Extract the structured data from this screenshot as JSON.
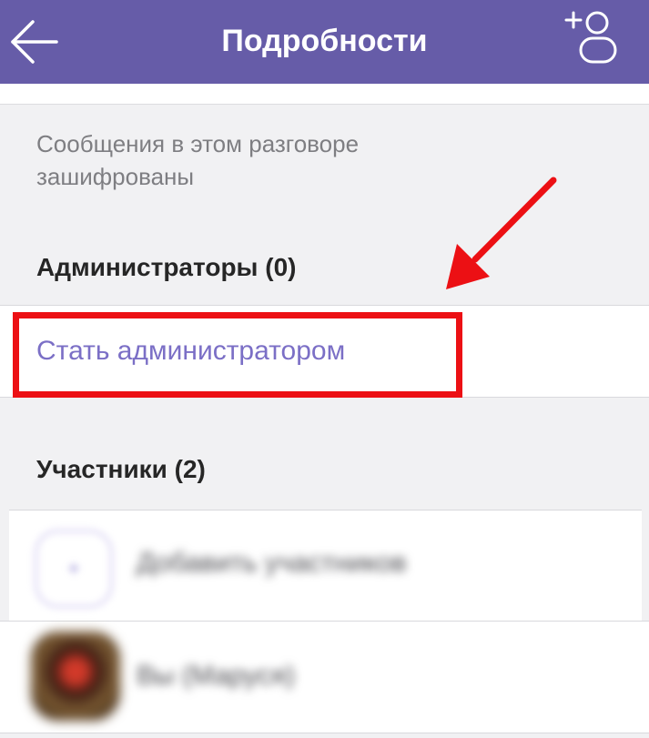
{
  "header": {
    "title": "Подробности",
    "back_icon": "arrow-left-icon",
    "add_contact_icon": "add-participant-icon",
    "background_color": "#665ca8"
  },
  "encryption_note": "Сообщения в этом разговоре зашифрованы",
  "admins": {
    "section_title": "Администраторы (0)",
    "become_admin_label": "Стать администратором"
  },
  "participants": {
    "section_title": "Участники (2)",
    "items": [
      {
        "label": "Добавить участников",
        "icon": "add-members-icon"
      },
      {
        "label": "Вы (Маруся)",
        "icon": "avatar"
      }
    ]
  },
  "annotation": {
    "color": "#ec1014"
  }
}
